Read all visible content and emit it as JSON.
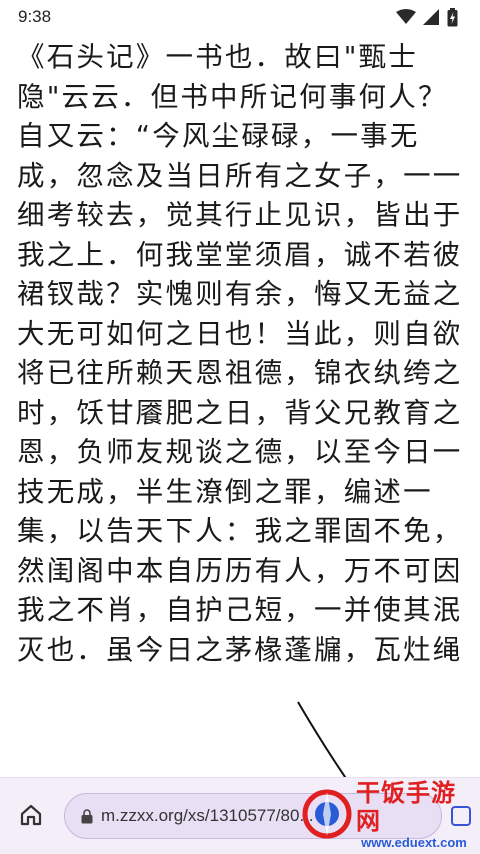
{
  "status_bar": {
    "time": "9:38",
    "icons": [
      "wifi-icon",
      "signal-icon",
      "battery-charging-icon"
    ]
  },
  "reader": {
    "lines": [
      "《石头记》一书也．故曰\"甄士",
      "隐\"云云．但书中所记何事何人？",
      "自又云：“今风尘碌碌，一事无",
      "成，忽念及当日所有之女子，一一",
      "细考较去，觉其行止见识，皆出于",
      "我之上．何我堂堂须眉，诚不若彼",
      "裙钗哉？实愧则有余，悔又无益之",
      "大无可如何之日也！当此，则自欲",
      "将已往所赖天恩祖德，锦衣纨绔之",
      "时，饫甘餍肥之日，背父兄教育之",
      "恩，负师友规谈之德，以至今日一",
      "技无成，半生潦倒之罪，编述一",
      "集，以告天下人：我之罪固不免，",
      "然闺阁中本自历历有人，万不可因",
      "我之不肖，自护己短，一并使其泯",
      "灭也．虽今日之茅椽蓬牖，瓦灶绳"
    ]
  },
  "browser": {
    "url": "m.zzxx.org/xs/1310577/80...",
    "home_icon": "home-icon",
    "lock_icon": "lock-icon",
    "tabs_icon": "tabs-icon",
    "accent_color": "#3b52d4"
  },
  "watermark": {
    "brand": "干饭手游网",
    "url": "www.eduext.com"
  }
}
